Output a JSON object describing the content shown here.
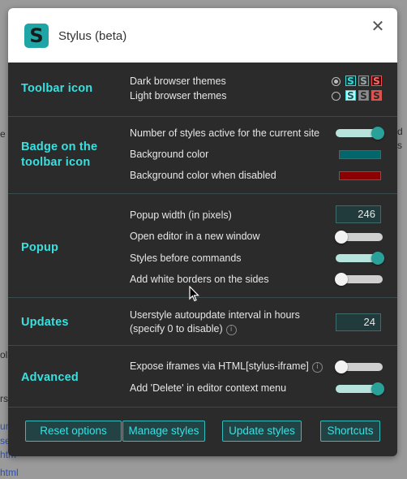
{
  "app": {
    "title": "Stylus (beta)",
    "logo_letter": "S"
  },
  "sections": {
    "toolbar_icon": {
      "title": "Toolbar icon",
      "dark_label": "Dark browser themes",
      "light_label": "Light browser themes"
    },
    "badge": {
      "title": "Badge on the toolbar icon",
      "count_label": "Number of styles active for the current site",
      "bg_color_label": "Background color",
      "bg_color": "#03666a",
      "bg_disabled_label": "Background color when disabled",
      "bg_disabled_color": "#8b0000"
    },
    "popup": {
      "title": "Popup",
      "width_label": "Popup width (in pixels)",
      "width_value": "246",
      "new_window_label": "Open editor in a new window",
      "styles_before_label": "Styles before commands",
      "white_borders_label": "Add white borders on the sides"
    },
    "updates": {
      "title": "Updates",
      "interval_label_1": "Userstyle autoupdate interval in hours",
      "interval_label_2": "(specify 0 to disable)",
      "interval_value": "24"
    },
    "advanced": {
      "title": "Advanced",
      "iframes_label": "Expose iframes via HTML[stylus-iframe]",
      "delete_label": "Add 'Delete' in editor context menu"
    }
  },
  "buttons": {
    "reset": "Reset options",
    "manage": "Manage styles",
    "update": "Update styles",
    "shortcuts": "Shortcuts"
  },
  "toggles": {
    "badge_count": true,
    "new_window": false,
    "styles_before": true,
    "white_borders": false,
    "iframes": false,
    "delete_menu": true
  },
  "radio_selected": "dark",
  "icons": {
    "close": "close-icon",
    "info": "info-icon",
    "dark_variant_colors": [
      "#3bd8d8",
      "#8a9a9a",
      "#ff4a4a"
    ],
    "light_variant_colors": [
      "#3bd8d8",
      "#7a7a7a",
      "#d9534f"
    ]
  },
  "colors": {
    "accent": "#39e0e0",
    "panel_bg": "#2b2b2b",
    "toggle_on": "#2aa198"
  }
}
